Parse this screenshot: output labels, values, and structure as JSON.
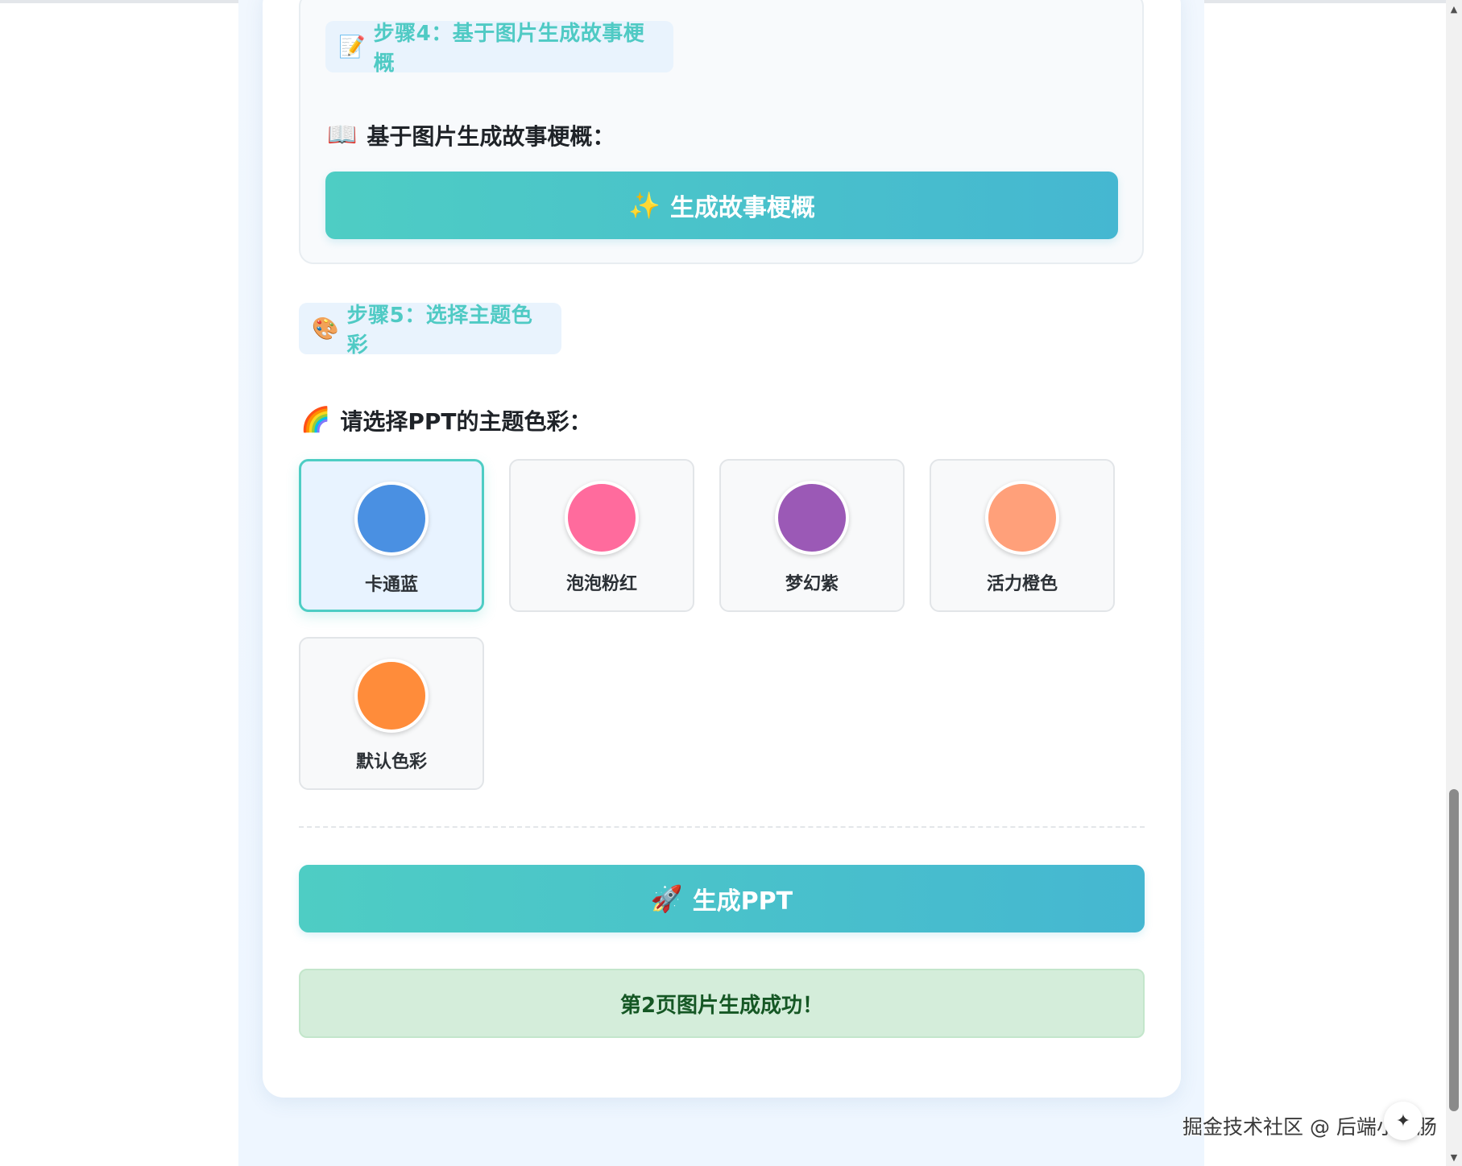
{
  "step4": {
    "tag_icon": "📝",
    "tag_label": "步骤4：基于图片生成故事梗概",
    "title_icon": "📖",
    "title": "基于图片生成故事梗概：",
    "button_icon": "✨",
    "button_label": "生成故事梗概"
  },
  "step5": {
    "tag_icon": "🎨",
    "tag_label": "步骤5：选择主题色彩",
    "title_icon": "🌈",
    "title": "请选择PPT的主题色彩：",
    "options": [
      {
        "label": "卡通蓝",
        "color": "#4a90e2",
        "selected": true
      },
      {
        "label": "泡泡粉红",
        "color": "#ff6b9d",
        "selected": false
      },
      {
        "label": "梦幻紫",
        "color": "#9b59b6",
        "selected": false
      },
      {
        "label": "活力橙色",
        "color": "#ffa07a",
        "selected": false
      },
      {
        "label": "默认色彩",
        "color": "#ff8c3a",
        "selected": false
      }
    ]
  },
  "generate_ppt": {
    "icon": "🚀",
    "label": "生成PPT"
  },
  "status": {
    "message": "第2页图片生成成功！"
  },
  "watermark": {
    "text": "掘金技术社区 @ 后端小肥肠"
  },
  "icons": {
    "scroll_up": "▲",
    "scroll_down": "▼",
    "ai_assistant": "✦"
  },
  "colors": {
    "accent_gradient_start": "#4ecdc4",
    "accent_gradient_end": "#45b7d1",
    "success_bg": "#d4edda",
    "success_text": "#155724"
  }
}
